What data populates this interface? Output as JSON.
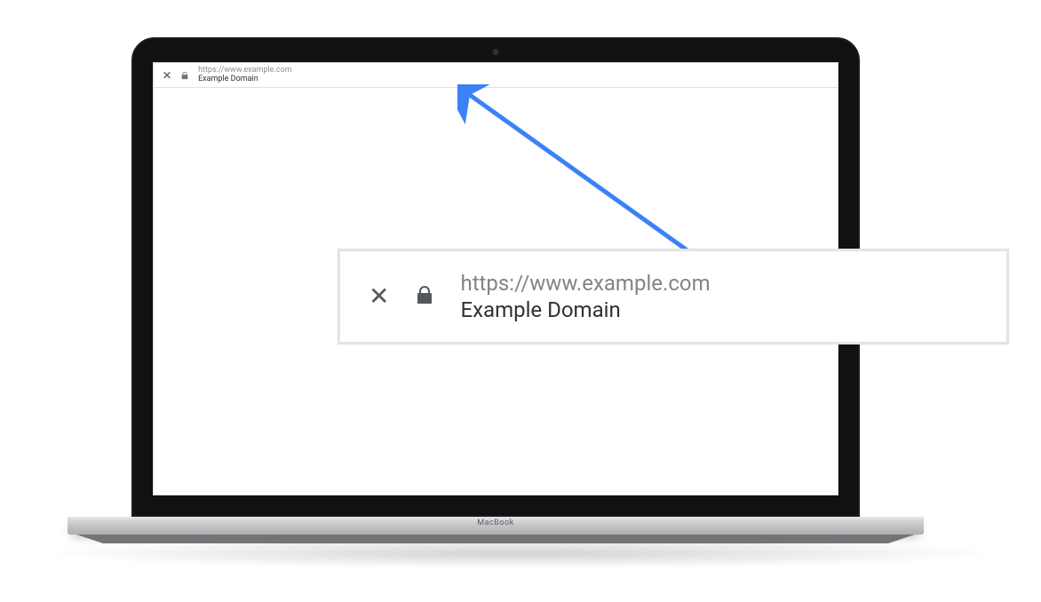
{
  "device": {
    "label": "MacBook"
  },
  "browser_small": {
    "url": "https://www.example.com",
    "title": "Example Domain"
  },
  "overlay": {
    "url": "https://www.example.com",
    "title": "Example Domain"
  },
  "colors": {
    "arrow": "#3b82f6"
  }
}
